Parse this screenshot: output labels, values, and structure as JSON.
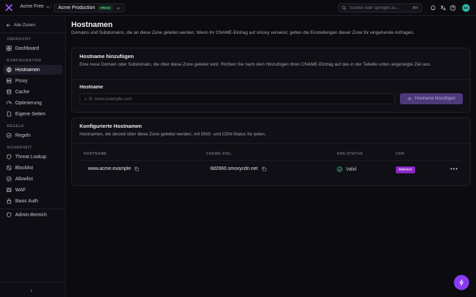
{
  "topbar": {
    "org_name": "Acme Free",
    "zone_name": "Acme Production",
    "zone_badge": "PROD",
    "search_placeholder": "Suchen oder springen zu...",
    "search_shortcut": "⌘K",
    "avatar_initials": "DA"
  },
  "sidebar": {
    "back_label": "Alle Zonen",
    "sections": {
      "overview": "ÜBERSICHT",
      "config": "KONFIGURATION",
      "rules": "REGELN",
      "security": "SICHERHEIT"
    },
    "items": {
      "dashboard": "Dashboard",
      "hostnames": "Hostnamen",
      "proxy": "Proxy",
      "cache": "Cache",
      "optimization": "Optimierung",
      "pages": "Eigene Seiten",
      "rules": "Regeln",
      "threat": "Threat Lookup",
      "blocklist": "Blocklist",
      "allowlist": "Allowlist",
      "waf": "WAF",
      "basic_auth": "Basic Auth",
      "admin": "Admin-Bereich"
    },
    "collapse_glyph": "‹"
  },
  "page": {
    "title": "Hostnamen",
    "subtitle": "Domains und Subdomains, die an diese Zone geleitet werden. Wenn ihr CNAME-Eintrag auf smoxy verweist, gelten die Einstellungen dieser Zone für eingehende Anfragen."
  },
  "add_card": {
    "title": "Hostname hinzufügen",
    "description": "Eine neue Domain oder Subdomain, die über diese Zone geleitet wird. Richten Sie nach dem Hinzufügen ihren CNAME-Eintrag auf das in der Tabelle unten angezeigte Ziel aus.",
    "field_label": "Hostname",
    "placeholder": "z. B. www.example.com",
    "button_label": "Hostname hinzufügen"
  },
  "list_card": {
    "title": "Konfigurierte Hostnamen",
    "description": "Hostnamen, die derzeit über diese Zone geleitet werden, mit DNS- und CDN-Status für jeden.",
    "columns": [
      "HOSTNAME",
      "CNAME-ZIEL",
      "DNS-STATUS",
      "CDN"
    ],
    "rows": [
      {
        "hostname": "www.acme.example",
        "cname": "8d2660.smoxycdn.net",
        "dns_status": "Valid",
        "cdn": "Aktiviert"
      }
    ]
  },
  "colors": {
    "accent": "#8a3bf0",
    "cdn_badge": "#8a25c9",
    "valid_green": "#4cc38a",
    "prod_green": "#5fd38a"
  }
}
